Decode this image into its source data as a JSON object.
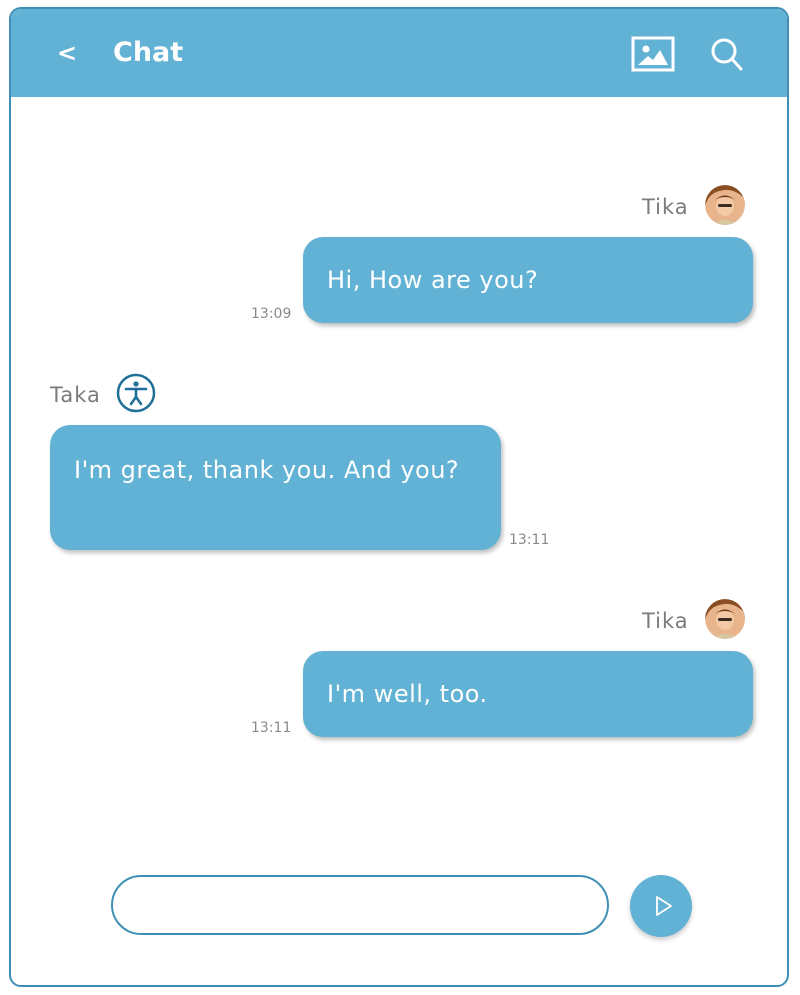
{
  "header": {
    "back_label": "<",
    "title": "Chat",
    "image_icon": "image-icon",
    "search_icon": "search-icon"
  },
  "messages": [
    {
      "sender": "Tika",
      "side": "right",
      "avatar": "photo-avatar",
      "text": "Hi, How are you?",
      "time": "13:09"
    },
    {
      "sender": "Taka",
      "side": "left",
      "avatar": "accessibility-icon",
      "text": "I'm great, thank you. And you?",
      "time": "13:11"
    },
    {
      "sender": "Tika",
      "side": "right",
      "avatar": "photo-avatar",
      "text": "I'm well, too.",
      "time": "13:11"
    }
  ],
  "composer": {
    "input_value": "",
    "send_icon": "play-icon"
  },
  "colors": {
    "accent": "#62b2d5",
    "border": "#3f8fb5",
    "bubble_text": "#ffffff",
    "sender_text": "#7b7b7b",
    "time_text": "#8a8a8a"
  }
}
